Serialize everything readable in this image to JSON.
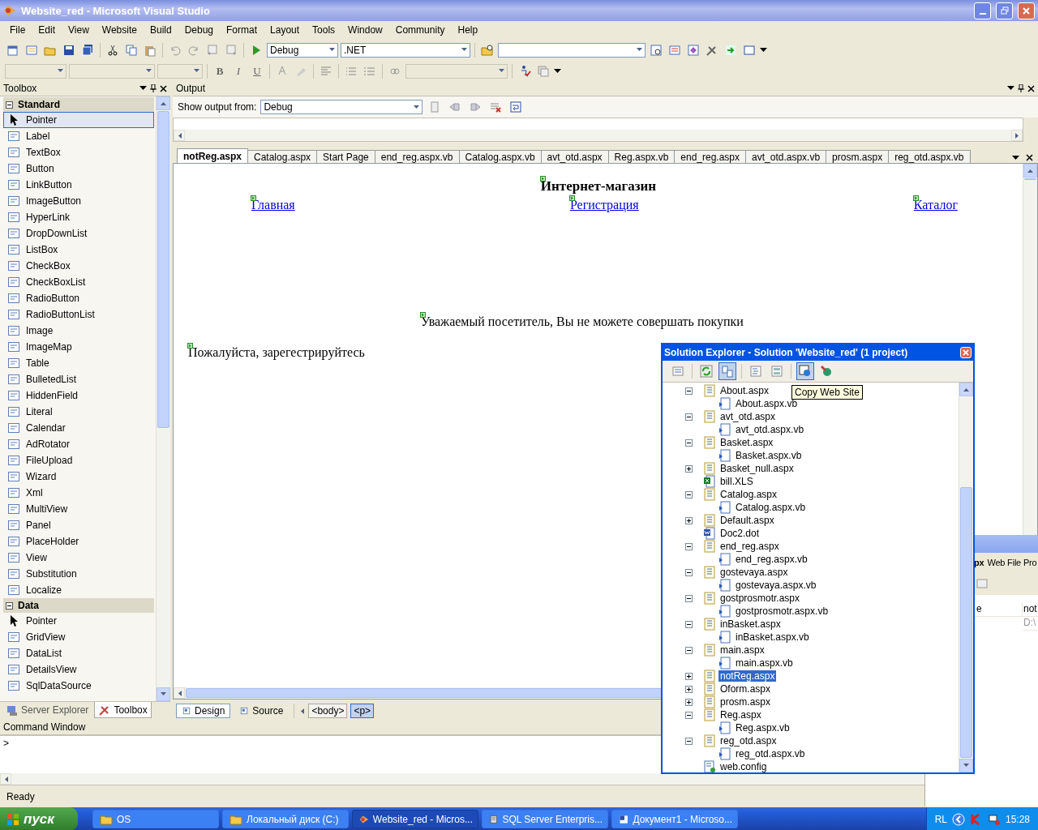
{
  "window": {
    "title": "Website_red - Microsoft Visual Studio"
  },
  "menu": [
    "File",
    "Edit",
    "View",
    "Website",
    "Build",
    "Debug",
    "Format",
    "Layout",
    "Tools",
    "Window",
    "Community",
    "Help"
  ],
  "toolbar": {
    "configuration": "Debug",
    "platform": ".NET",
    "format_buttons": [
      "B",
      "I",
      "U"
    ]
  },
  "toolbox": {
    "title": "Toolbox",
    "sections": [
      {
        "label": "Standard",
        "expanded": true,
        "items": [
          {
            "label": "Pointer",
            "selected": true
          },
          {
            "label": "Label",
            "selected": false
          },
          {
            "label": "TextBox",
            "selected": false
          },
          {
            "label": "Button",
            "selected": false
          },
          {
            "label": "LinkButton",
            "selected": false
          },
          {
            "label": "ImageButton",
            "selected": false
          },
          {
            "label": "HyperLink",
            "selected": false
          },
          {
            "label": "DropDownList",
            "selected": false
          },
          {
            "label": "ListBox",
            "selected": false
          },
          {
            "label": "CheckBox",
            "selected": false
          },
          {
            "label": "CheckBoxList",
            "selected": false
          },
          {
            "label": "RadioButton",
            "selected": false
          },
          {
            "label": "RadioButtonList",
            "selected": false
          },
          {
            "label": "Image",
            "selected": false
          },
          {
            "label": "ImageMap",
            "selected": false
          },
          {
            "label": "Table",
            "selected": false
          },
          {
            "label": "BulletedList",
            "selected": false
          },
          {
            "label": "HiddenField",
            "selected": false
          },
          {
            "label": "Literal",
            "selected": false
          },
          {
            "label": "Calendar",
            "selected": false
          },
          {
            "label": "AdRotator",
            "selected": false
          },
          {
            "label": "FileUpload",
            "selected": false
          },
          {
            "label": "Wizard",
            "selected": false
          },
          {
            "label": "Xml",
            "selected": false
          },
          {
            "label": "MultiView",
            "selected": false
          },
          {
            "label": "Panel",
            "selected": false
          },
          {
            "label": "PlaceHolder",
            "selected": false
          },
          {
            "label": "View",
            "selected": false
          },
          {
            "label": "Substitution",
            "selected": false
          },
          {
            "label": "Localize",
            "selected": false
          }
        ]
      },
      {
        "label": "Data",
        "expanded": true,
        "items": [
          {
            "label": "Pointer",
            "selected": false
          },
          {
            "label": "GridView",
            "selected": false
          },
          {
            "label": "DataList",
            "selected": false
          },
          {
            "label": "DetailsView",
            "selected": false
          },
          {
            "label": "SqlDataSource",
            "selected": false
          }
        ]
      }
    ],
    "tabs": [
      {
        "label": "Server Explorer",
        "selected": false
      },
      {
        "label": "Toolbox",
        "selected": true
      }
    ]
  },
  "output": {
    "title": "Output",
    "show_from_label": "Show output from:",
    "source": "Debug"
  },
  "editor": {
    "tabs": [
      {
        "label": "notReg.aspx",
        "selected": true
      },
      {
        "label": "Catalog.aspx",
        "selected": false
      },
      {
        "label": "Start Page",
        "selected": false
      },
      {
        "label": "end_reg.aspx.vb",
        "selected": false
      },
      {
        "label": "Catalog.aspx.vb",
        "selected": false
      },
      {
        "label": "avt_otd.aspx",
        "selected": false
      },
      {
        "label": "Reg.aspx.vb",
        "selected": false
      },
      {
        "label": "end_reg.aspx",
        "selected": false
      },
      {
        "label": "avt_otd.aspx.vb",
        "selected": false
      },
      {
        "label": "prosm.aspx",
        "selected": false
      },
      {
        "label": "reg_otd.aspx.vb",
        "selected": false
      }
    ],
    "page": {
      "heading": "Интернет-магазин",
      "links": [
        "Главная",
        "Регистрация",
        "Каталог"
      ],
      "notice": "Уважаемый посетитель, Вы не можете совершать покупки",
      "prompt": "Пожалуйста, зарегестрируйтесь"
    },
    "views": [
      {
        "label": "Design",
        "selected": true
      },
      {
        "label": "Source",
        "selected": false
      }
    ],
    "tags": [
      {
        "label": "<body>",
        "selected": false
      },
      {
        "label": "<p>",
        "selected": true
      }
    ]
  },
  "command_window": {
    "title": "Command Window",
    "prompt": ">"
  },
  "status_bar": {
    "text": "Ready"
  },
  "solution_explorer": {
    "title": "Solution Explorer - Solution 'Website_red' (1 project)",
    "tooltip": "Copy Web Site",
    "items": [
      {
        "label": "About.aspx",
        "kind": "page",
        "expanded": true,
        "selected": false,
        "children": [
          {
            "label": "About.aspx.vb",
            "kind": "code",
            "selected": false
          }
        ]
      },
      {
        "label": "avt_otd.aspx",
        "kind": "page",
        "expanded": true,
        "selected": false,
        "children": [
          {
            "label": "avt_otd.aspx.vb",
            "kind": "code",
            "selected": false
          }
        ]
      },
      {
        "label": "Basket.aspx",
        "kind": "page",
        "expanded": true,
        "selected": false,
        "children": [
          {
            "label": "Basket.aspx.vb",
            "kind": "code",
            "selected": false
          }
        ]
      },
      {
        "label": "Basket_null.aspx",
        "kind": "page",
        "expanded": false,
        "selected": false
      },
      {
        "label": "bill.XLS",
        "kind": "excel",
        "selected": false
      },
      {
        "label": "Catalog.aspx",
        "kind": "page",
        "expanded": true,
        "selected": false,
        "children": [
          {
            "label": "Catalog.aspx.vb",
            "kind": "code",
            "selected": false
          }
        ]
      },
      {
        "label": "Default.aspx",
        "kind": "page",
        "expanded": false,
        "selected": false
      },
      {
        "label": "Doc2.dot",
        "kind": "word",
        "selected": false
      },
      {
        "label": "end_reg.aspx",
        "kind": "page",
        "expanded": true,
        "selected": false,
        "children": [
          {
            "label": "end_reg.aspx.vb",
            "kind": "code",
            "selected": false
          }
        ]
      },
      {
        "label": "gostevaya.aspx",
        "kind": "page",
        "expanded": true,
        "selected": false,
        "children": [
          {
            "label": "gostevaya.aspx.vb",
            "kind": "code",
            "selected": false
          }
        ]
      },
      {
        "label": "gostprosmotr.aspx",
        "kind": "page",
        "expanded": true,
        "selected": false,
        "children": [
          {
            "label": "gostprosmotr.aspx.vb",
            "kind": "code",
            "selected": false
          }
        ]
      },
      {
        "label": "inBasket.aspx",
        "kind": "page",
        "expanded": true,
        "selected": false,
        "children": [
          {
            "label": "inBasket.aspx.vb",
            "kind": "code",
            "selected": false
          }
        ]
      },
      {
        "label": "main.aspx",
        "kind": "page",
        "expanded": true,
        "selected": false,
        "children": [
          {
            "label": "main.aspx.vb",
            "kind": "code",
            "selected": false
          }
        ]
      },
      {
        "label": "notReg.aspx",
        "kind": "page",
        "expanded": false,
        "selected": true
      },
      {
        "label": "Oform.aspx",
        "kind": "page",
        "expanded": false,
        "selected": false
      },
      {
        "label": "prosm.aspx",
        "kind": "page",
        "expanded": false,
        "selected": false
      },
      {
        "label": "Reg.aspx",
        "kind": "page",
        "expanded": true,
        "selected": false,
        "children": [
          {
            "label": "Reg.aspx.vb",
            "kind": "code",
            "selected": false
          }
        ]
      },
      {
        "label": "reg_otd.aspx",
        "kind": "page",
        "expanded": true,
        "selected": false,
        "children": [
          {
            "label": "reg_otd.aspx.vb",
            "kind": "code",
            "selected": false
          }
        ]
      },
      {
        "label": "web.config",
        "kind": "config",
        "selected": false
      }
    ]
  },
  "properties_window": {
    "file": "px",
    "title": "Web File Pro",
    "column_1": "e",
    "column_2": "not",
    "value": "D:\\"
  },
  "taskbar": {
    "start": "пуск",
    "tasks": [
      {
        "label": "OS",
        "selected": false
      },
      {
        "label": "Локальный диск (C:)",
        "selected": false
      },
      {
        "label": "Website_red - Micros...",
        "selected": true
      },
      {
        "label": "SQL Server Enterpris...",
        "selected": false
      },
      {
        "label": "Документ1 - Microso...",
        "selected": false
      }
    ],
    "language": "RL",
    "clock": "15:28"
  }
}
